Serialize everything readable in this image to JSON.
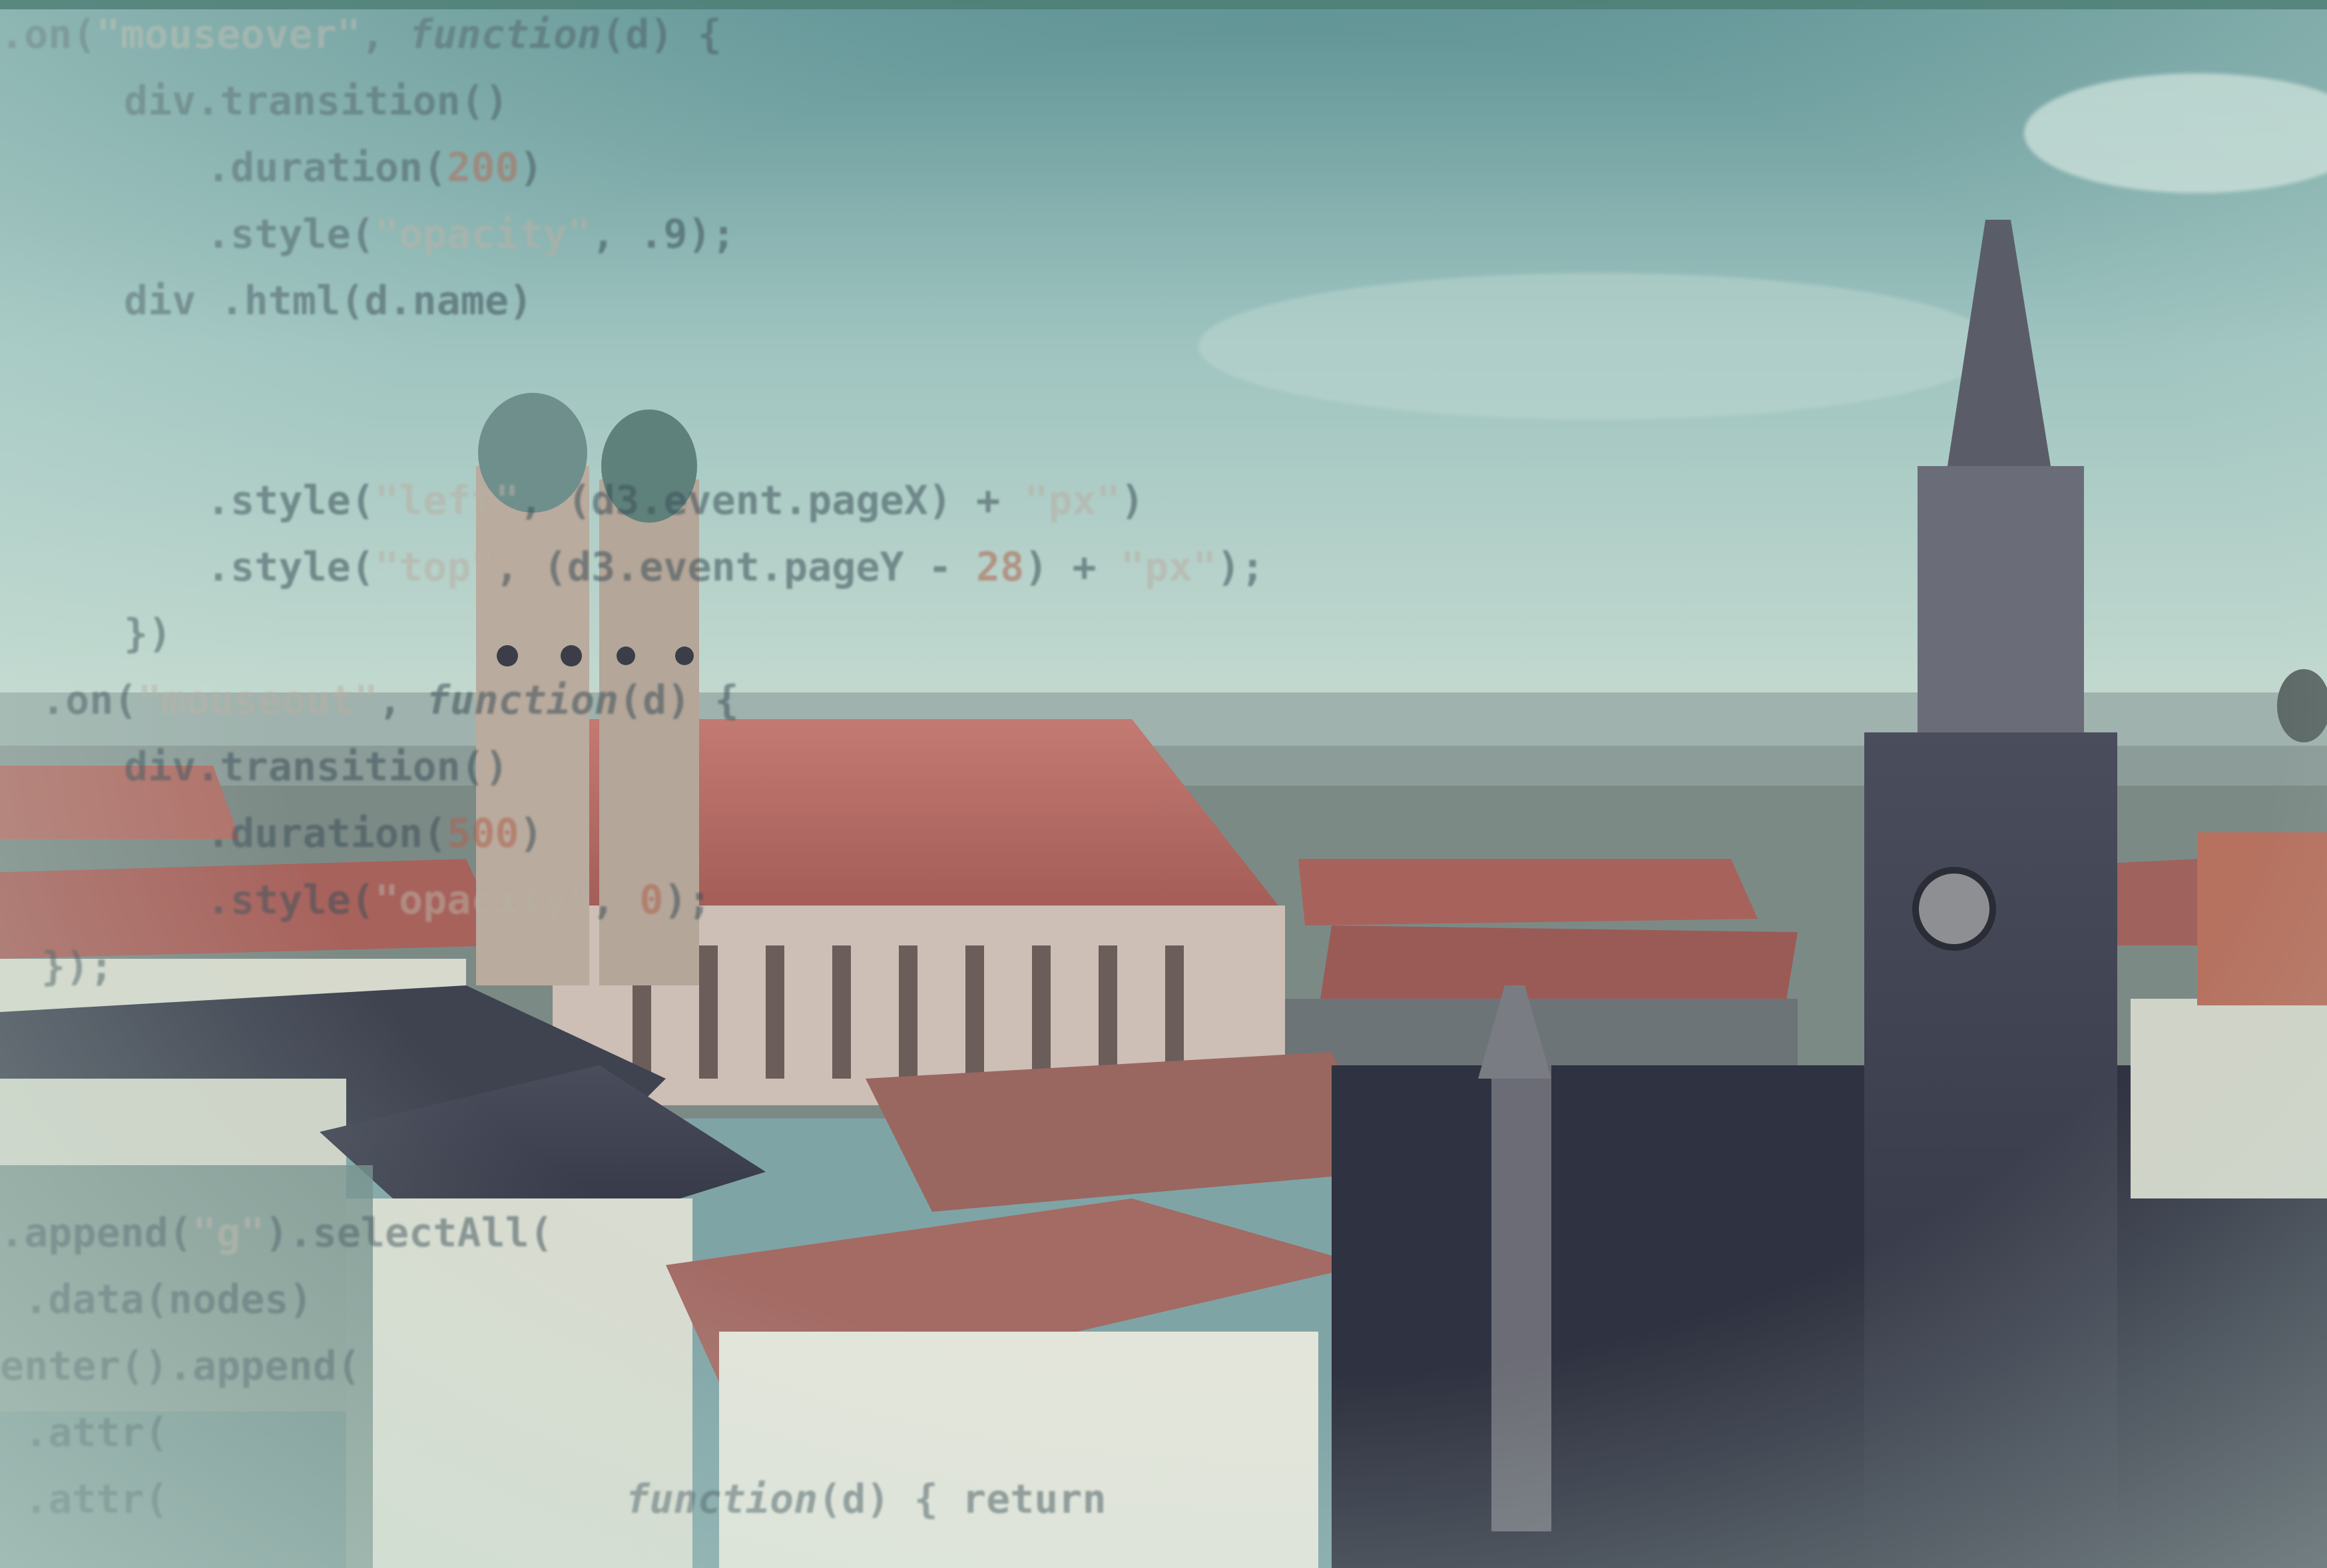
{
  "image": {
    "subject": "Munich skyline with Frauenkirche towers and Neues Rathaus clock tower, overlaid with semi-transparent D3.js JavaScript code",
    "palette": {
      "sky": "#7fb0b0",
      "roof_red": "#b56a63",
      "dark_stone": "#3c4050",
      "light_wall": "#d8dccf",
      "code_text": "#3c4f58",
      "code_string": "#b8afa4",
      "code_number": "#b0614c"
    }
  },
  "code_overlay": {
    "lines": [
      {
        "indent": 0,
        "tokens": [
          {
            "t": ".on(",
            "c": ""
          },
          {
            "t": "\"mouseover\"",
            "c": "str"
          },
          {
            "t": ", ",
            "c": ""
          },
          {
            "t": "function",
            "c": "kw"
          },
          {
            "t": "(d) {",
            "c": ""
          }
        ]
      },
      {
        "indent": 3,
        "tokens": [
          {
            "t": "div.transition()",
            "c": ""
          }
        ]
      },
      {
        "indent": 5,
        "tokens": [
          {
            "t": ".duration(",
            "c": ""
          },
          {
            "t": "200",
            "c": "num"
          },
          {
            "t": ")",
            "c": ""
          }
        ]
      },
      {
        "indent": 5,
        "tokens": [
          {
            "t": ".style(",
            "c": ""
          },
          {
            "t": "\"opacity\"",
            "c": "str"
          },
          {
            "t": ", .9);",
            "c": ""
          }
        ]
      },
      {
        "indent": 3,
        "tokens": [
          {
            "t": "div .html(d.name)",
            "c": ""
          }
        ]
      },
      {
        "indent": 0,
        "tokens": []
      },
      {
        "indent": 0,
        "tokens": []
      },
      {
        "indent": 5,
        "tokens": [
          {
            "t": ".style(",
            "c": ""
          },
          {
            "t": "\"left\"",
            "c": "str"
          },
          {
            "t": ", (d3.event.pageX) + ",
            "c": ""
          },
          {
            "t": "\"px\"",
            "c": "str"
          },
          {
            "t": ")",
            "c": ""
          }
        ]
      },
      {
        "indent": 5,
        "tokens": [
          {
            "t": ".style(",
            "c": ""
          },
          {
            "t": "\"top\"",
            "c": "str"
          },
          {
            "t": ", (d3.event.pageY - ",
            "c": ""
          },
          {
            "t": "28",
            "c": "num"
          },
          {
            "t": ") + ",
            "c": ""
          },
          {
            "t": "\"px\"",
            "c": "str"
          },
          {
            "t": ");",
            "c": ""
          }
        ]
      },
      {
        "indent": 3,
        "tokens": [
          {
            "t": "})",
            "c": ""
          }
        ]
      },
      {
        "indent": 1,
        "tokens": [
          {
            "t": ".on(",
            "c": ""
          },
          {
            "t": "\"mouseout\"",
            "c": "str"
          },
          {
            "t": ", ",
            "c": ""
          },
          {
            "t": "function",
            "c": "kw"
          },
          {
            "t": "(d) {",
            "c": ""
          }
        ]
      },
      {
        "indent": 3,
        "tokens": [
          {
            "t": "div.transition()",
            "c": ""
          }
        ]
      },
      {
        "indent": 5,
        "tokens": [
          {
            "t": ".duration(",
            "c": ""
          },
          {
            "t": "500",
            "c": "num"
          },
          {
            "t": ")",
            "c": ""
          }
        ]
      },
      {
        "indent": 5,
        "tokens": [
          {
            "t": ".style(",
            "c": ""
          },
          {
            "t": "\"opacity\"",
            "c": "str"
          },
          {
            "t": ", ",
            "c": ""
          },
          {
            "t": "0",
            "c": "num"
          },
          {
            "t": ");",
            "c": ""
          }
        ]
      },
      {
        "indent": 1,
        "tokens": [
          {
            "t": "});",
            "c": ""
          }
        ]
      },
      {
        "indent": 0,
        "tokens": []
      },
      {
        "indent": 0,
        "tokens": []
      },
      {
        "indent": 0,
        "tokens": []
      },
      {
        "indent": 0,
        "tokens": [
          {
            "t": ".append(",
            "c": ""
          },
          {
            "t": "\"g\"",
            "c": "str"
          },
          {
            "t": ").selectAll(",
            "c": ""
          }
        ]
      },
      {
        "indent": 0,
        "tokens": [
          {
            "t": " .data(nodes)",
            "c": ""
          }
        ]
      },
      {
        "indent": 0,
        "tokens": [
          {
            "t": "enter().append(",
            "c": ""
          }
        ]
      },
      {
        "indent": 0,
        "tokens": [
          {
            "t": " .attr(",
            "c": ""
          }
        ]
      },
      {
        "indent": 0,
        "tokens": [
          {
            "t": " .attr(",
            "c": ""
          },
          {
            "t": "                   ",
            "c": ""
          },
          {
            "t": "function",
            "c": "kw"
          },
          {
            "t": "(d) { return ",
            "c": ""
          }
        ]
      }
    ]
  }
}
